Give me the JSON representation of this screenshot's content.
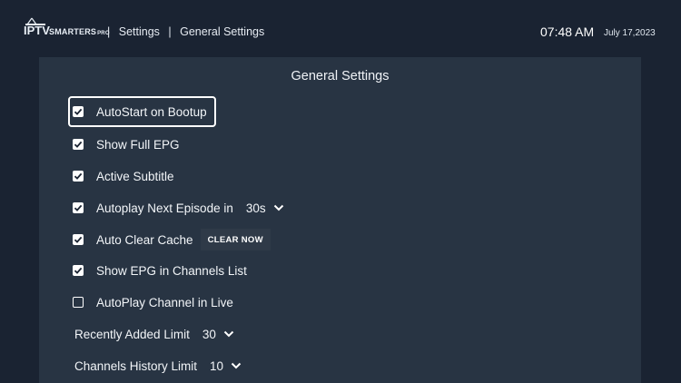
{
  "header": {
    "logo_iptv": "IPTV",
    "logo_smarters": "SMARTERS",
    "logo_pro": "PRO",
    "breadcrumb_sep": "|",
    "breadcrumb_1": "Settings",
    "breadcrumb_2": "General Settings",
    "time": "07:48 AM",
    "date": "July 17,2023"
  },
  "panel": {
    "title": "General Settings",
    "options": [
      {
        "label": "AutoStart on Bootup",
        "checked": true,
        "focused": true
      },
      {
        "label": "Show Full EPG",
        "checked": true
      },
      {
        "label": "Active Subtitle",
        "checked": true
      },
      {
        "label": "Autoplay Next Episode in",
        "checked": true,
        "select_value": "30s"
      },
      {
        "label": "Auto Clear Cache",
        "checked": true,
        "button_label": "CLEAR NOW"
      },
      {
        "label": "Show EPG in Channels List",
        "checked": true
      },
      {
        "label": "AutoPlay Channel in Live",
        "checked": false
      }
    ],
    "limits": [
      {
        "label": "Recently Added Limit",
        "value": "30"
      },
      {
        "label": "Channels History Limit",
        "value": "10"
      }
    ]
  },
  "colors": {
    "background": "#1a2332",
    "panel": "#283443",
    "text": "#ffffff"
  }
}
